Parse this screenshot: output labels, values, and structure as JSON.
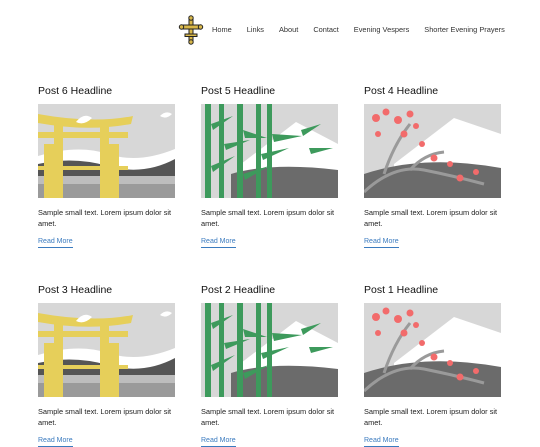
{
  "nav": {
    "logo_icon": "ornate-cross-icon",
    "items": [
      "Home",
      "Links",
      "About",
      "Contact",
      "Evening Vespers",
      "Shorter Evening Prayers"
    ]
  },
  "posts": [
    {
      "headline": "Post 6 Headline",
      "excerpt": "Sample small text. Lorem ipsum dolor sit amet.",
      "read_more": "Read More",
      "image": "torii-gate"
    },
    {
      "headline": "Post 5 Headline",
      "excerpt": "Sample small text. Lorem ipsum dolor sit amet.",
      "read_more": "Read More",
      "image": "bamboo"
    },
    {
      "headline": "Post 4 Headline",
      "excerpt": "Sample small text. Lorem ipsum dolor sit amet.",
      "read_more": "Read More",
      "image": "cherry-blossom"
    },
    {
      "headline": "Post 3 Headline",
      "excerpt": "Sample small text. Lorem ipsum dolor sit amet.",
      "read_more": "Read More",
      "image": "torii-gate"
    },
    {
      "headline": "Post 2 Headline",
      "excerpt": "Sample small text. Lorem ipsum dolor sit amet.",
      "read_more": "Read More",
      "image": "bamboo"
    },
    {
      "headline": "Post 1 Headline",
      "excerpt": "Sample small text. Lorem ipsum dolor sit amet.",
      "read_more": "Read More",
      "image": "cherry-blossom"
    }
  ],
  "colors": {
    "link": "#3b7bbf",
    "torii": "#e6cf5a",
    "bamboo": "#3d9a5c",
    "blossom": "#f26b6b",
    "mountain_gray": "#6d6d6d"
  }
}
